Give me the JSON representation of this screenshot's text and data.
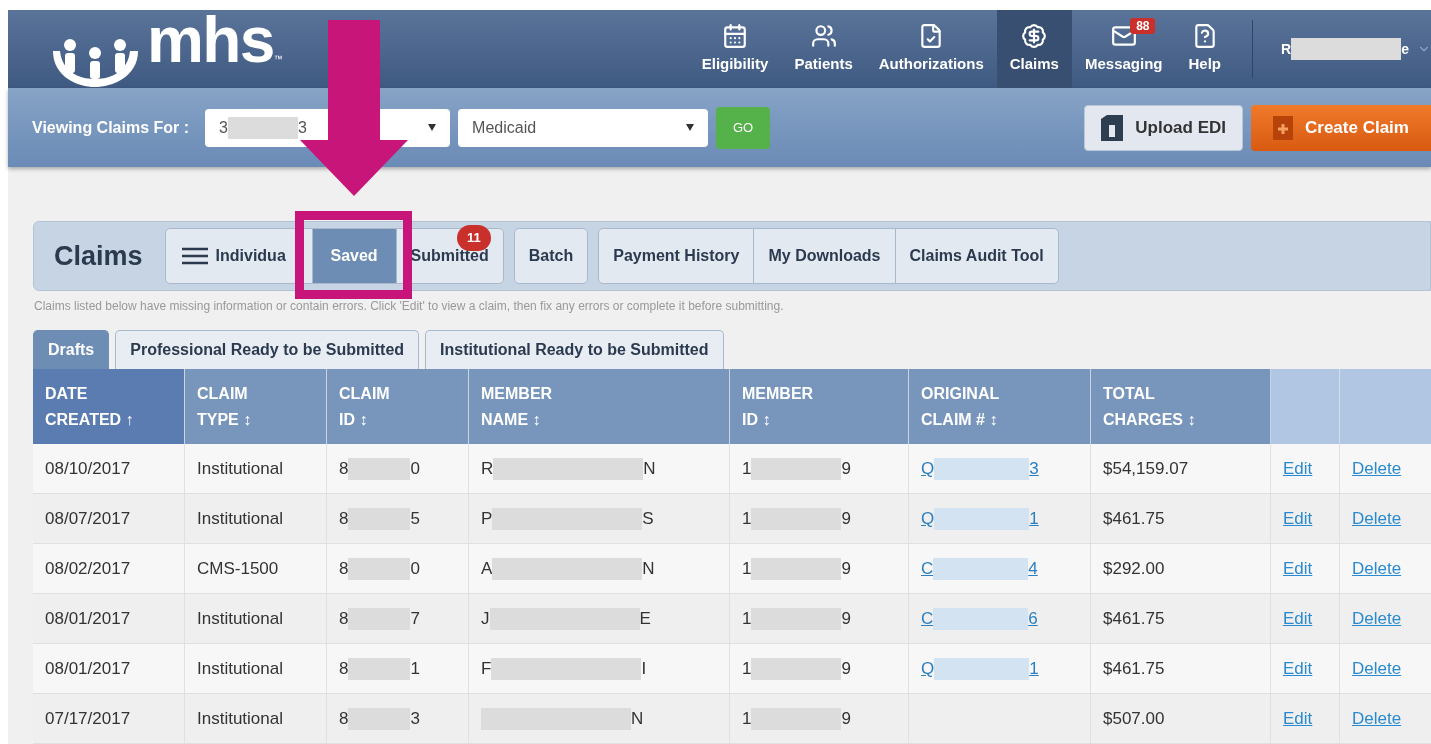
{
  "logo": {
    "text": "mhs",
    "mark": "™"
  },
  "nav": [
    {
      "label": "Eligibility",
      "selected": false
    },
    {
      "label": "Patients",
      "selected": false
    },
    {
      "label": "Authorizations",
      "selected": false
    },
    {
      "label": "Claims",
      "selected": true
    },
    {
      "label": "Messaging",
      "selected": false,
      "badge": "88"
    },
    {
      "label": "Help",
      "selected": false
    }
  ],
  "user": {
    "start": "R",
    "end": "e"
  },
  "toolbar": {
    "label": "Viewing Claims For :",
    "member": {
      "start": "3",
      "end": "3"
    },
    "plan": "Medicaid",
    "go": "GO",
    "upload": "Upload EDI",
    "create": "Create Claim"
  },
  "claims": {
    "title": "Claims",
    "groups": [
      {
        "items": [
          {
            "label": "Individua",
            "selected": false,
            "kind": "menu"
          },
          {
            "label": "Saved",
            "selected": true
          },
          {
            "label": "Submitted",
            "selected": false,
            "badge": "11"
          }
        ]
      },
      {
        "items": [
          {
            "label": "Batch",
            "selected": false
          }
        ]
      },
      {
        "items": [
          {
            "label": "Payment History",
            "selected": false
          },
          {
            "label": "My Downloads",
            "selected": false
          },
          {
            "label": "Claims Audit Tool",
            "selected": false
          }
        ]
      }
    ],
    "note": "Claims listed below have missing information or contain errors. Click 'Edit' to view a claim, then fix any errors or complete it before submitting."
  },
  "subtabs": [
    {
      "label": "Drafts",
      "selected": true
    },
    {
      "label": "Professional Ready to be Submitted",
      "selected": false
    },
    {
      "label": "Institutional Ready to be Submitted",
      "selected": false
    }
  ],
  "table": {
    "columns": [
      {
        "line1": "DATE",
        "line2": "CREATED ↑",
        "selected": true
      },
      {
        "line1": "CLAIM",
        "line2": "TYPE ↕",
        "selected": false
      },
      {
        "line1": "CLAIM",
        "line2": "ID ↕",
        "selected": false
      },
      {
        "line1": "MEMBER",
        "line2": "NAME ↕",
        "selected": false
      },
      {
        "line1": "MEMBER",
        "line2": "ID ↕",
        "selected": false
      },
      {
        "line1": "ORIGINAL",
        "line2": "CLAIM # ↕",
        "selected": false
      },
      {
        "line1": "TOTAL",
        "line2": "CHARGES ↕",
        "selected": false
      }
    ],
    "rows": [
      {
        "date": "08/10/2017",
        "type": "Institutional",
        "claim_id": {
          "start": "8",
          "end": "0"
        },
        "member_name": {
          "start": "R",
          "end": "N"
        },
        "member_id": {
          "start": "1",
          "end": "9"
        },
        "original": {
          "start": "Q",
          "end": "3"
        },
        "charges": "$54,159.07",
        "edit": "Edit",
        "delete": "Delete"
      },
      {
        "date": "08/07/2017",
        "type": "Institutional",
        "claim_id": {
          "start": "8",
          "end": "5"
        },
        "member_name": {
          "start": "P",
          "end": "S"
        },
        "member_id": {
          "start": "1",
          "end": "9"
        },
        "original": {
          "start": "Q",
          "end": "1"
        },
        "charges": "$461.75",
        "edit": "Edit",
        "delete": "Delete"
      },
      {
        "date": "08/02/2017",
        "type": "CMS-1500",
        "claim_id": {
          "start": "8",
          "end": "0"
        },
        "member_name": {
          "start": "A",
          "end": "N"
        },
        "member_id": {
          "start": "1",
          "end": "9"
        },
        "original": {
          "start": "C",
          "end": "4"
        },
        "charges": "$292.00",
        "edit": "Edit",
        "delete": "Delete"
      },
      {
        "date": "08/01/2017",
        "type": "Institutional",
        "claim_id": {
          "start": "8",
          "end": "7"
        },
        "member_name": {
          "start": "J",
          "end": "E"
        },
        "member_id": {
          "start": "1",
          "end": "9"
        },
        "original": {
          "start": "C",
          "end": "6"
        },
        "charges": "$461.75",
        "edit": "Edit",
        "delete": "Delete"
      },
      {
        "date": "08/01/2017",
        "type": "Institutional",
        "claim_id": {
          "start": "8",
          "end": "1"
        },
        "member_name": {
          "start": "F",
          "end": "I"
        },
        "member_id": {
          "start": "1",
          "end": "9"
        },
        "original": {
          "start": "Q",
          "end": "1"
        },
        "charges": "$461.75",
        "edit": "Edit",
        "delete": "Delete"
      },
      {
        "date": "07/17/2017",
        "type": "Institutional",
        "claim_id": {
          "start": "8",
          "end": "3"
        },
        "member_name": {
          "end": "N"
        },
        "member_id": {
          "start": "1",
          "end": "9"
        },
        "charges": "$507.00",
        "edit": "Edit",
        "delete": "Delete"
      }
    ]
  }
}
